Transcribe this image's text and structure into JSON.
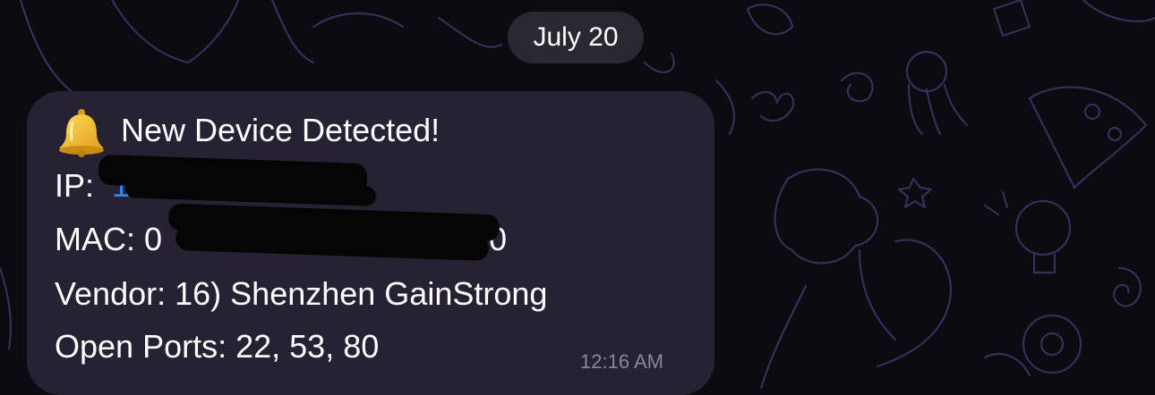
{
  "chat": {
    "date_label": "July 20"
  },
  "message": {
    "title": "New Device Detected!",
    "ip_label": "IP:",
    "ip_value": "[redacted]",
    "mac_label": "MAC:",
    "mac_value_start": "0",
    "mac_value_end": "0",
    "vendor_label": "Vendor:",
    "vendor_value": "16) Shenzhen GainStrong",
    "ports_label": "Open Ports:",
    "ports_value": "22, 53, 80",
    "time": "12:16 AM",
    "icon": "bell-icon"
  },
  "colors": {
    "background": "#0b0b11",
    "bubble": "#262234",
    "date_pill": "#2a2931",
    "link": "#3b82e6",
    "timestamp": "#8b8799"
  }
}
